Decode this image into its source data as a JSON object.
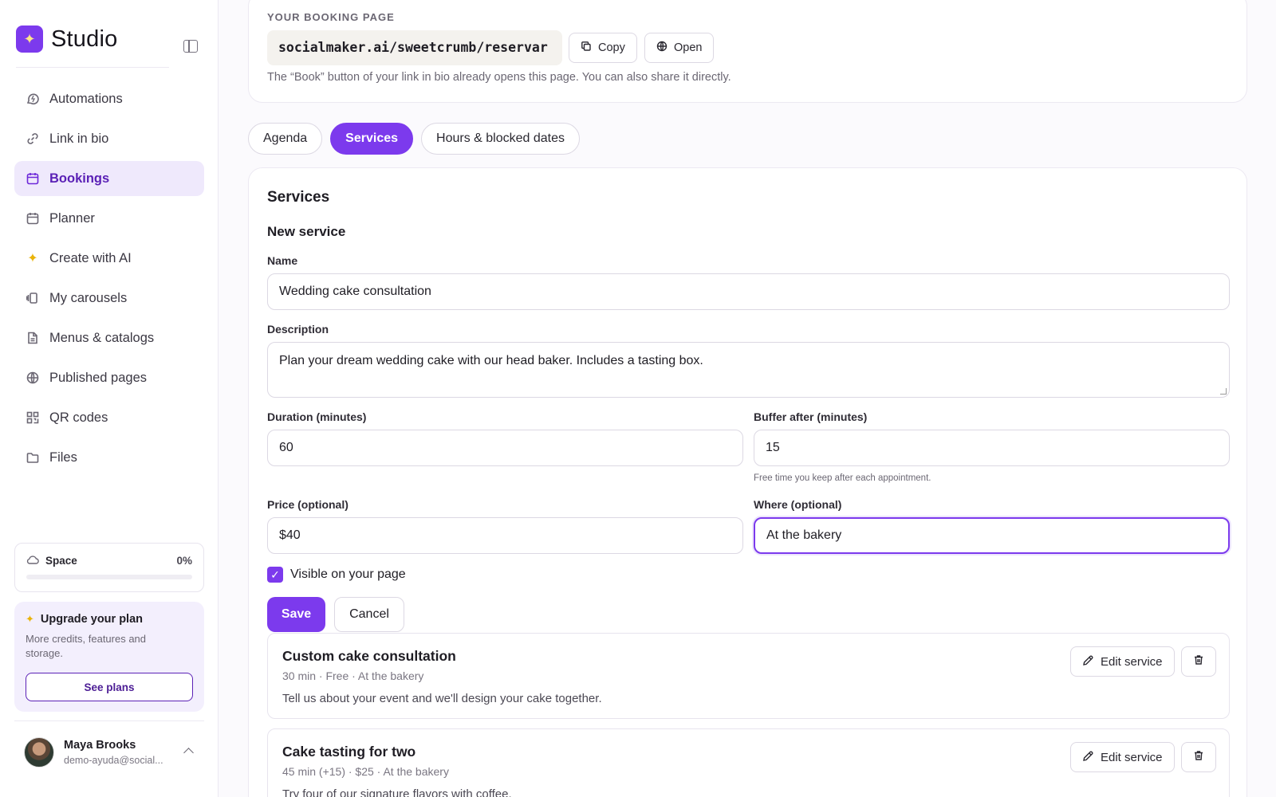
{
  "app": {
    "name": "Studio"
  },
  "sidebar": {
    "items": [
      {
        "label": "Automations",
        "icon": "automation-icon"
      },
      {
        "label": "Link in bio",
        "icon": "link-icon"
      },
      {
        "label": "Bookings",
        "icon": "calendar-icon",
        "active": true
      },
      {
        "label": "Planner",
        "icon": "calendar-icon"
      },
      {
        "label": "Create with AI",
        "icon": "sparkle-icon"
      },
      {
        "label": "My carousels",
        "icon": "carousel-icon"
      },
      {
        "label": "Menus & catalogs",
        "icon": "document-icon"
      },
      {
        "label": "Published pages",
        "icon": "globe-icon"
      },
      {
        "label": "QR codes",
        "icon": "qr-icon"
      },
      {
        "label": "Files",
        "icon": "folder-icon"
      }
    ],
    "space": {
      "label": "Space",
      "percent_label": "0%",
      "percent": 0
    },
    "upgrade": {
      "title": "Upgrade your plan",
      "description": "More credits, features and storage.",
      "button": "See plans"
    },
    "user": {
      "name": "Maya Brooks",
      "email": "demo-ayuda@social..."
    }
  },
  "booking_page": {
    "label": "YOUR BOOKING PAGE",
    "url": "socialmaker.ai/sweetcrumb/reservar",
    "copy_label": "Copy",
    "open_label": "Open",
    "hint": "The “Book” button of your link in bio already opens this page. You can also share it directly."
  },
  "tabs": [
    {
      "label": "Agenda",
      "active": false
    },
    {
      "label": "Services",
      "active": true
    },
    {
      "label": "Hours & blocked dates",
      "active": false
    }
  ],
  "services": {
    "title": "Services",
    "form": {
      "title": "New service",
      "name_label": "Name",
      "name_value": "Wedding cake consultation",
      "description_label": "Description",
      "description_value": "Plan your dream wedding cake with our head baker. Includes a tasting box.",
      "duration_label": "Duration (minutes)",
      "duration_value": "60",
      "buffer_label": "Buffer after (minutes)",
      "buffer_value": "15",
      "buffer_help": "Free time you keep after each appointment.",
      "price_label": "Price (optional)",
      "price_value": "$40",
      "where_label": "Where (optional)",
      "where_value": "At the bakery",
      "visible_label": "Visible on your page",
      "visible_checked": true,
      "save_label": "Save",
      "cancel_label": "Cancel"
    },
    "list": [
      {
        "name": "Custom cake consultation",
        "meta": "30 min · Free · At the bakery",
        "description": "Tell us about your event and we'll design your cake together.",
        "edit_label": "Edit service"
      },
      {
        "name": "Cake tasting for two",
        "meta": "45 min (+15) · $25 · At the bakery",
        "description": "Try four of our signature flavors with coffee.",
        "edit_label": "Edit service"
      }
    ]
  },
  "colors": {
    "accent": "#7c3aed",
    "accent_light": "#efe9fc"
  }
}
